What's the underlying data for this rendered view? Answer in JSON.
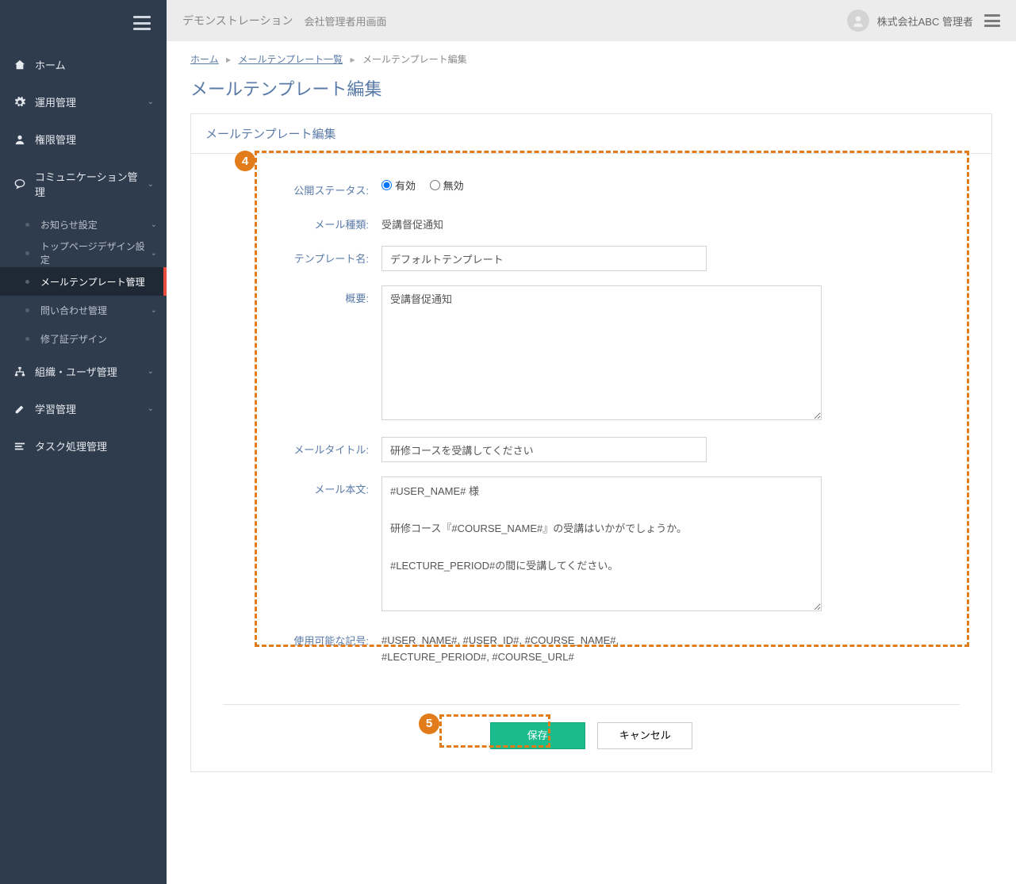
{
  "topbar": {
    "brand": "デモンストレーション",
    "admin_screen": "会社管理者用画面",
    "user": "株式会社ABC 管理者"
  },
  "sidebar": {
    "home": "ホーム",
    "operations": "運用管理",
    "permissions": "権限管理",
    "communication": "コミュニケーション管理",
    "comm_sub": {
      "notice": "お知らせ設定",
      "top_design": "トップページデザイン設定",
      "mail_template": "メールテンプレート管理",
      "inquiry": "問い合わせ管理",
      "certificate": "修了証デザイン"
    },
    "org_user": "組織・ユーザ管理",
    "learning": "学習管理",
    "task": "タスク処理管理"
  },
  "breadcrumb": {
    "home": "ホーム",
    "list": "メールテンプレート一覧",
    "current": "メールテンプレート編集"
  },
  "page_title": "メールテンプレート編集",
  "panel_title": "メールテンプレート編集",
  "annotations": {
    "four": "4",
    "five": "5"
  },
  "form": {
    "labels": {
      "publish_status": "公開ステータス:",
      "mail_type": "メール種類:",
      "template_name": "テンプレート名:",
      "summary": "概要:",
      "mail_title": "メールタイトル:",
      "mail_body": "メール本文:",
      "available_symbols": "使用可能な記号:"
    },
    "radio": {
      "enabled": "有効",
      "disabled": "無効"
    },
    "values": {
      "mail_type": "受講督促通知",
      "template_name": "デフォルトテンプレート",
      "summary": "受講督促通知",
      "mail_title": "研修コースを受講してください",
      "mail_body": "#USER_NAME# 様\n\n研修コース『#COURSE_NAME#』の受講はいかがでしょうか。\n\n#LECTURE_PERIOD#の間に受講してください。",
      "available_symbols": "#USER_NAME#, #USER_ID#, #COURSE_NAME#, #LECTURE_PERIOD#, #COURSE_URL#"
    }
  },
  "buttons": {
    "save": "保存",
    "cancel": "キャンセル"
  }
}
